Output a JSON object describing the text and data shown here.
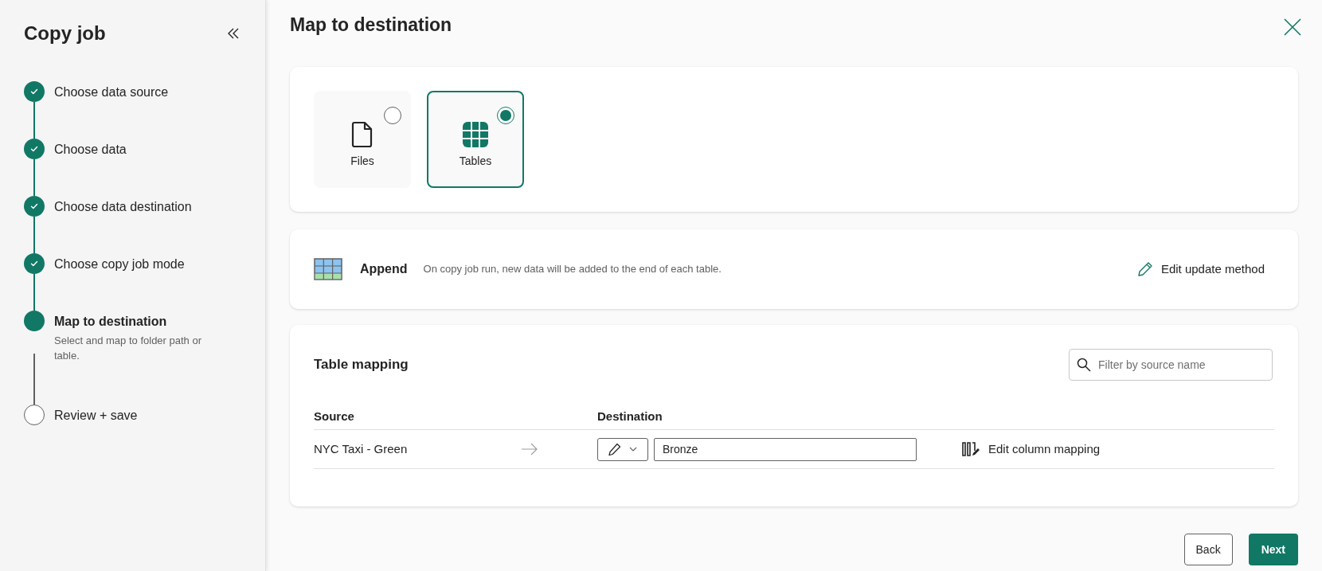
{
  "sidebar": {
    "title": "Copy job",
    "steps": [
      {
        "label": "Choose data source",
        "kind": "done",
        "selected": false
      },
      {
        "label": "Choose data",
        "kind": "done",
        "selected": false
      },
      {
        "label": "Choose data destination",
        "kind": "done",
        "selected": false
      },
      {
        "label": "Choose copy job mode",
        "kind": "done",
        "selected": false
      },
      {
        "label": "Map to destination",
        "kind": "current",
        "selected": true,
        "description": "Select and map to folder path or table."
      },
      {
        "label": "Review + save",
        "kind": "pending",
        "selected": false
      }
    ]
  },
  "page": {
    "title": "Map to destination"
  },
  "destination_types": [
    {
      "label": "Files",
      "kind": "file",
      "selected": false
    },
    {
      "label": "Tables",
      "kind": "table",
      "selected": true
    }
  ],
  "update_method": {
    "name": "Append",
    "description": "On copy job run, new data will be added to the end of each table.",
    "action": "Edit update method"
  },
  "table_mapping": {
    "title": "Table mapping",
    "search": {
      "placeholder": "Filter by source name"
    },
    "columns": [
      "Source",
      "Destination"
    ],
    "rows": [
      {
        "source": "NYC Taxi - Green",
        "destination": "Bronze",
        "action": "Edit column mapping"
      }
    ]
  },
  "buttons": [
    {
      "label": "Back",
      "kind": "secondary"
    },
    {
      "label": "Next",
      "kind": "primary"
    }
  ]
}
